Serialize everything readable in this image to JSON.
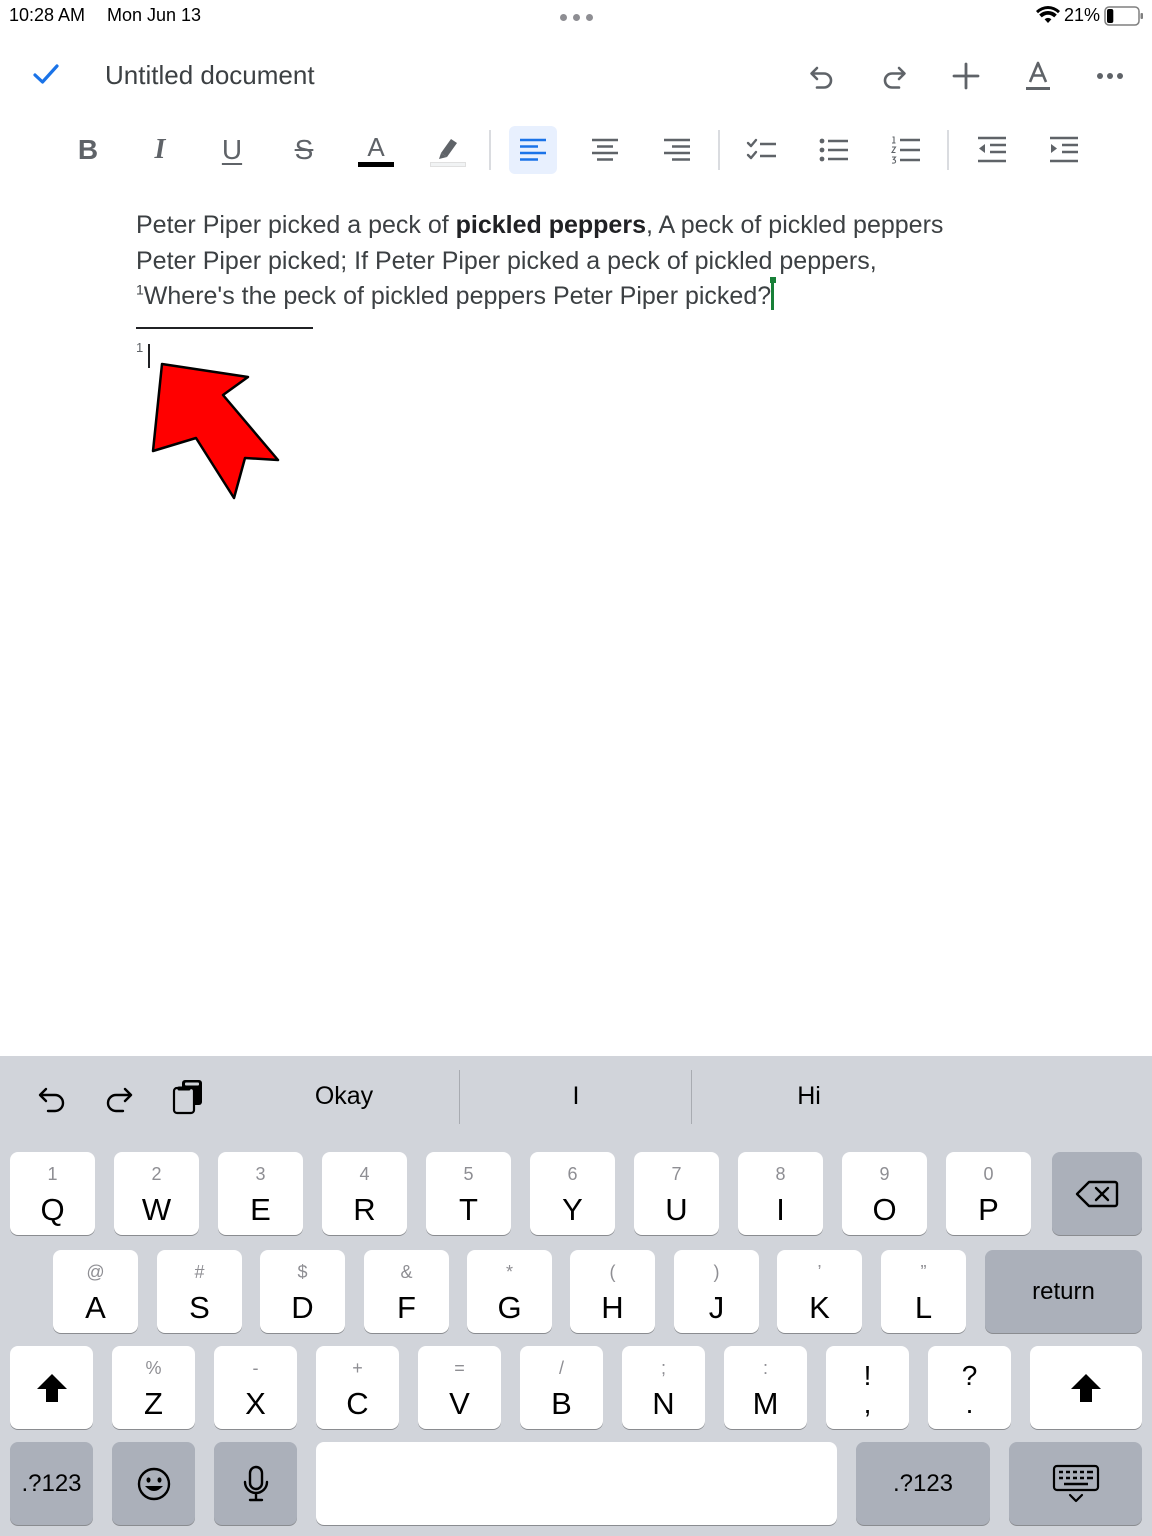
{
  "status_bar": {
    "time": "10:28 AM",
    "date": "Mon Jun 13",
    "battery_percent": "21%",
    "battery_level": 0.21
  },
  "header": {
    "title": "Untitled document",
    "icons": [
      "check-icon",
      "undo-icon",
      "redo-icon",
      "insert-plus-icon",
      "text-format-icon",
      "more-options-icon"
    ]
  },
  "toolbar": {
    "bold": "B",
    "italic": "I",
    "underline": "U",
    "strikethrough": "S",
    "text_color": "A",
    "text_color_value": "#000000",
    "active_alignment": "left"
  },
  "document": {
    "line1_part1": "Peter Piper picked a peck of ",
    "line1_bold": "pickled peppers",
    "line1_part2": ", A peck of pickled peppers",
    "line2": "Peter Piper picked; If Peter Piper picked a peck of pickled peppers,",
    "footnote_ref": "1",
    "line3": "Where's the peck of pickled peppers Peter Piper picked?",
    "footnote_number": "1"
  },
  "keyboard": {
    "suggestions": [
      "Okay",
      "I",
      "Hi"
    ],
    "row1": [
      {
        "alt": "1",
        "key": "Q"
      },
      {
        "alt": "2",
        "key": "W"
      },
      {
        "alt": "3",
        "key": "E"
      },
      {
        "alt": "4",
        "key": "R"
      },
      {
        "alt": "5",
        "key": "T"
      },
      {
        "alt": "6",
        "key": "Y"
      },
      {
        "alt": "7",
        "key": "U"
      },
      {
        "alt": "8",
        "key": "I"
      },
      {
        "alt": "9",
        "key": "O"
      },
      {
        "alt": "0",
        "key": "P"
      }
    ],
    "row2": [
      {
        "alt": "@",
        "key": "A"
      },
      {
        "alt": "#",
        "key": "S"
      },
      {
        "alt": "$",
        "key": "D"
      },
      {
        "alt": "&",
        "key": "F"
      },
      {
        "alt": "*",
        "key": "G"
      },
      {
        "alt": "(",
        "key": "H"
      },
      {
        "alt": ")",
        "key": "J"
      },
      {
        "alt": "’",
        "key": "K"
      },
      {
        "alt": "”",
        "key": "L"
      }
    ],
    "return_label": "return",
    "row3": [
      {
        "alt": "%",
        "key": "Z"
      },
      {
        "alt": "-",
        "key": "X"
      },
      {
        "alt": "+",
        "key": "C"
      },
      {
        "alt": "=",
        "key": "V"
      },
      {
        "alt": "/",
        "key": "B"
      },
      {
        "alt": ";",
        "key": "N"
      },
      {
        "alt": ":",
        "key": "M"
      }
    ],
    "exclam_top": "!",
    "exclam_bottom": ",",
    "question_top": "?",
    "question_bottom": ".",
    "numbers_label": ".?123"
  },
  "colors": {
    "accent_blue": "#1a73e8",
    "cursor_green": "#188038",
    "arrow_red": "#ff0000",
    "keyboard_bg": "#d1d4da"
  }
}
